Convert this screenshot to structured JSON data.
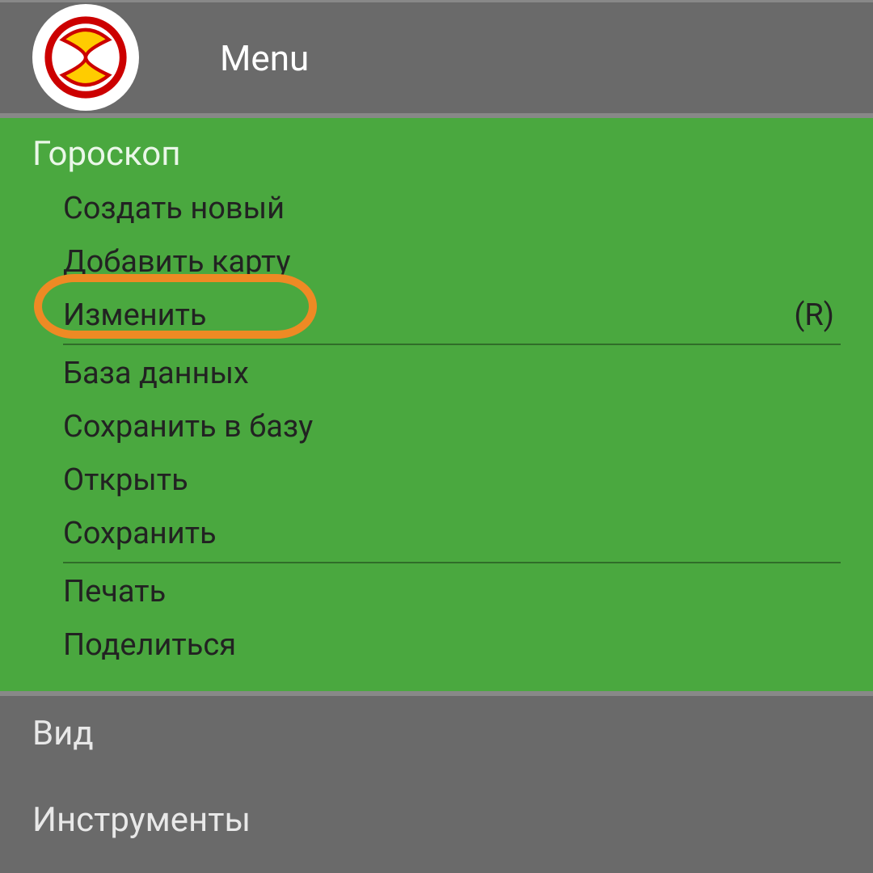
{
  "header": {
    "title": "Menu"
  },
  "sections": {
    "horoscope": {
      "title": "Гороскоп",
      "items": [
        {
          "label": "Создать новый",
          "shortcut": ""
        },
        {
          "label": "Добавить карту",
          "shortcut": ""
        },
        {
          "label": "Изменить",
          "shortcut": "(R)"
        },
        {
          "label": "База данных",
          "shortcut": ""
        },
        {
          "label": "Сохранить в базу",
          "shortcut": ""
        },
        {
          "label": "Открыть",
          "shortcut": ""
        },
        {
          "label": "Сохранить",
          "shortcut": ""
        },
        {
          "label": "Печать",
          "shortcut": ""
        },
        {
          "label": "Поделиться",
          "shortcut": ""
        }
      ]
    },
    "view": {
      "title": "Вид"
    },
    "tools": {
      "title": "Инструменты"
    }
  },
  "annotations": {
    "highlight": "Создать новый"
  }
}
